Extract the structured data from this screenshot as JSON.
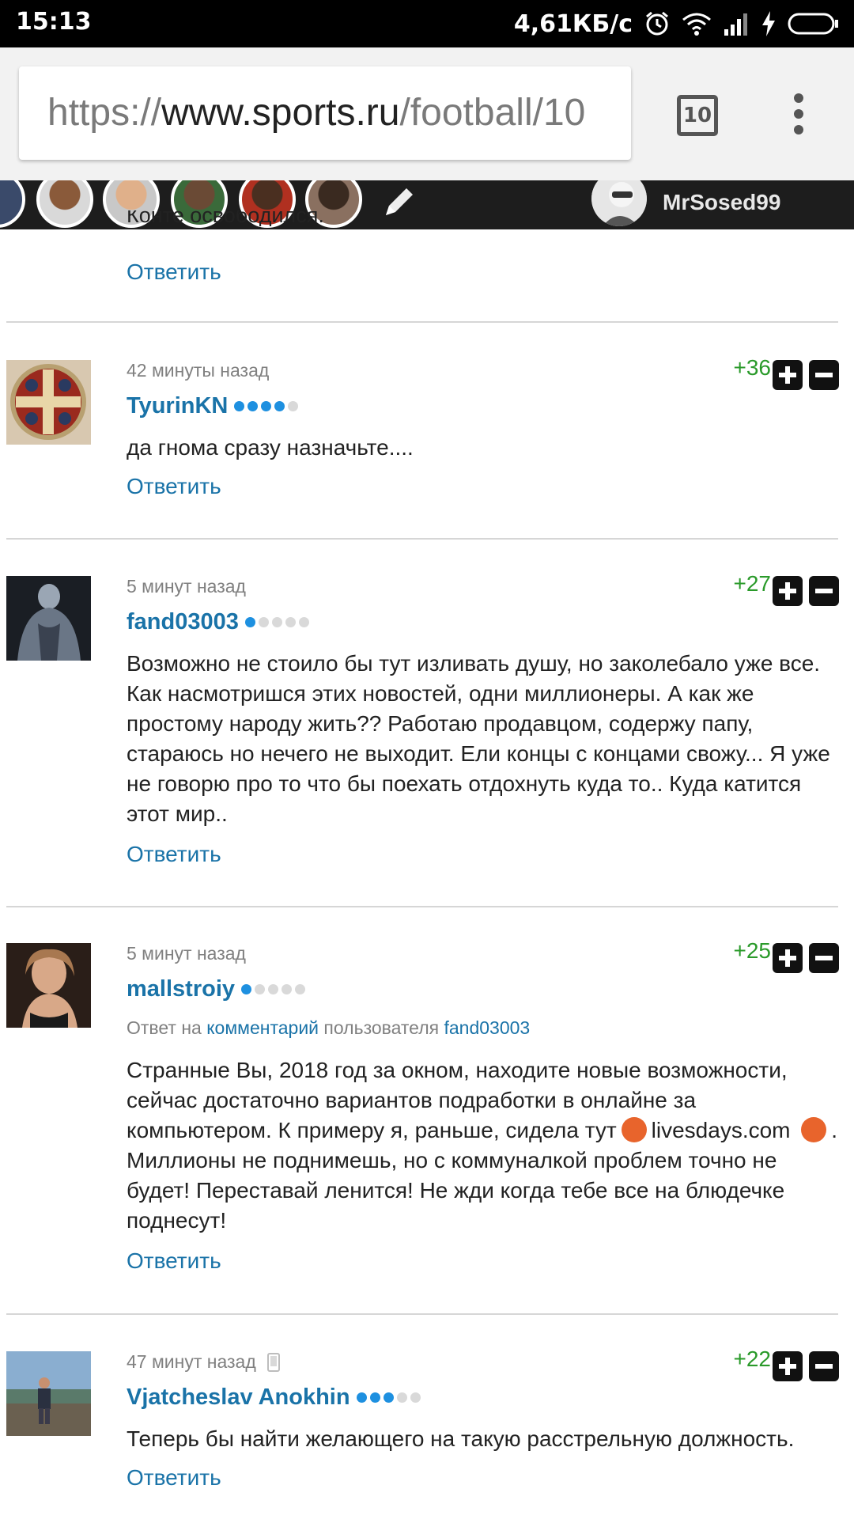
{
  "status_bar": {
    "time": "15:13",
    "net_speed": "4,61КБ/с",
    "icons": [
      "alarm-icon",
      "wifi-icon",
      "signal-icon",
      "charging-icon",
      "battery-icon"
    ]
  },
  "browser": {
    "url_scheme": "https://",
    "url_host": "www.sports.ru",
    "url_path": "/football/10",
    "tab_count": "10"
  },
  "user_strip": {
    "username": "MrSosed99"
  },
  "previous_comment": {
    "cutoff_text": "Конте освободился.",
    "reply_label": "Ответить"
  },
  "comments": [
    {
      "time": "42 минуты назад",
      "score": "+36",
      "author": "TyurinKN",
      "rating_dots": [
        1,
        1,
        1,
        1,
        0
      ],
      "text": "да гнома сразу назначьте....",
      "reply_label": "Ответить"
    },
    {
      "time": "5 минут назад",
      "score": "+27",
      "author": "fand03003",
      "rating_dots": [
        1,
        0,
        0,
        0,
        0
      ],
      "text": "Возможно не стоило бы тут изливать душу, но заколебало уже все. Как насмотришся этих новостей, одни миллионеры. А как же простому народу жить?? Работаю продавцом, содержу папу, стараюсь но нечего не выходит. Ели концы с концами свожу... Я уже не говорю про то что бы поехать отдохнуть куда то.. Куда катится этот мир..",
      "reply_label": "Ответить"
    },
    {
      "time": "5 минут назад",
      "score": "+25",
      "author": "mallstroiy",
      "rating_dots": [
        1,
        0,
        0,
        0,
        0
      ],
      "reply_to_prefix": "Ответ на",
      "reply_to_link": "комментарий",
      "reply_to_middle": "пользователя",
      "reply_to_user": "fand03003",
      "text_part1": "Странные Вы, 2018 год за окном, находите новые возможности, сейчас достаточно вариантов подработки в онлайне за компьютером. К примеру я, раньше, сидела тут",
      "text_link": "livesdays.com",
      "text_part2": ". Миллионы не поднимешь, но с коммуналкой проблем точно не будет! Переставай ленится! Не жди когда тебе все на блюдечке поднесут!",
      "reply_label": "Ответить"
    },
    {
      "time": "47 минут назад",
      "score": "+22",
      "author": "Vjatcheslav Anokhin",
      "rating_dots": [
        1,
        1,
        1,
        0,
        0
      ],
      "text": "Теперь бы найти желающего на такую расстрельную должность.",
      "reply_label": "Ответить"
    }
  ]
}
